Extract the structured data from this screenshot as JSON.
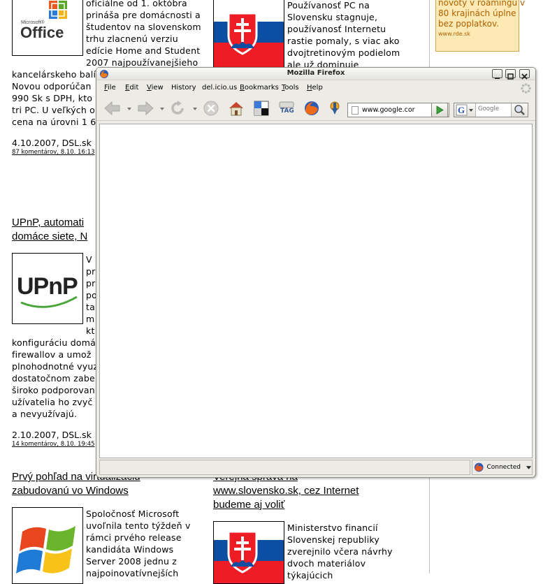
{
  "page": {
    "article1": {
      "right_text": "oficiálne od 1. októbra\nprináša pre domácnosti a\nštudentov na slovenskom\ntrhu zlacnenú verziu\nedície Home and Student\n2007 najpoužívanejšieho",
      "body_lines": [
        "kancelárskeho balí",
        "Novou odporúčan",
        "990 Sk s DPH, kto",
        "tri PC. U veľkých o",
        "cena na úrovni 1 6"
      ],
      "date": "4.10.2007, DSL.sk",
      "comments": "87 komentárov, 8.10. 16:13",
      "logo_small": "Microsoft®",
      "logo_big": "Office"
    },
    "article2": {
      "right_text": "Používanosť PC na\nSlovensku stagnuje,\npoužívanosť Internetu\nrastie pomaly, s viac ako\ndvojtretinovým podielom\nale už dominuje"
    },
    "ad": {
      "text": "novoty v roamingu v\n80 krajinách úplne\nbez poplatkov.",
      "url": "www.rde.sk"
    },
    "article3": {
      "headline": "UPnP, automati\ndomáce siete, N",
      "logo": "UPnP",
      "right_col": "V\npr\npr\npo\nta\nm\nkt",
      "body": "konfiguráciu domá\nfirewallov a umož\nplnohodnotné vyuz\ndostatočnom zabe\nširoko podporovan\nužívatelia ho zvyč\na nevyužívajú.",
      "date": "2.10.2007, DSL.sk",
      "comments": "14 komentárov, 8.10. 19:45"
    },
    "article4": {
      "headline": "Prvý pohľad na virtualizáciu\nzabudovanú vo Windows",
      "text": "Spoločnosť Microsoft\nuvoľnila tento týždeň v\nrámci prvého release\nkandidáta Windows\nServer 2008 jednu z\nnajpoinovatívnejších"
    },
    "article5": {
      "headline": "Verejná správa na\nwww.slovensko.sk, cez Internet\nbudeme aj voliť",
      "text": "Ministerstvo financií\nSlovenskej republiky\nzverejnilo včera návrhy\ndvoch materiálov\ntýkajúcich"
    }
  },
  "browser": {
    "title": "Mozilla Firefox",
    "menu": [
      {
        "acc": "F",
        "rest": "ile"
      },
      {
        "acc": "E",
        "rest": "dit"
      },
      {
        "acc": "V",
        "rest": "iew"
      },
      {
        "acc": "",
        "rest": "History"
      },
      {
        "acc": "",
        "rest": "del.icio.us"
      },
      {
        "acc": "B",
        "rest": "ookmarks"
      },
      {
        "acc": "T",
        "rest": "ools"
      },
      {
        "acc": "H",
        "rest": "elp"
      }
    ],
    "url": "www.google.cor",
    "search_placeholder": "Google",
    "tag_label": "TAG",
    "status": {
      "connection": "Connected"
    },
    "colors": {
      "accent": "#2a5ab8",
      "go_green": "#3aa23a"
    }
  }
}
